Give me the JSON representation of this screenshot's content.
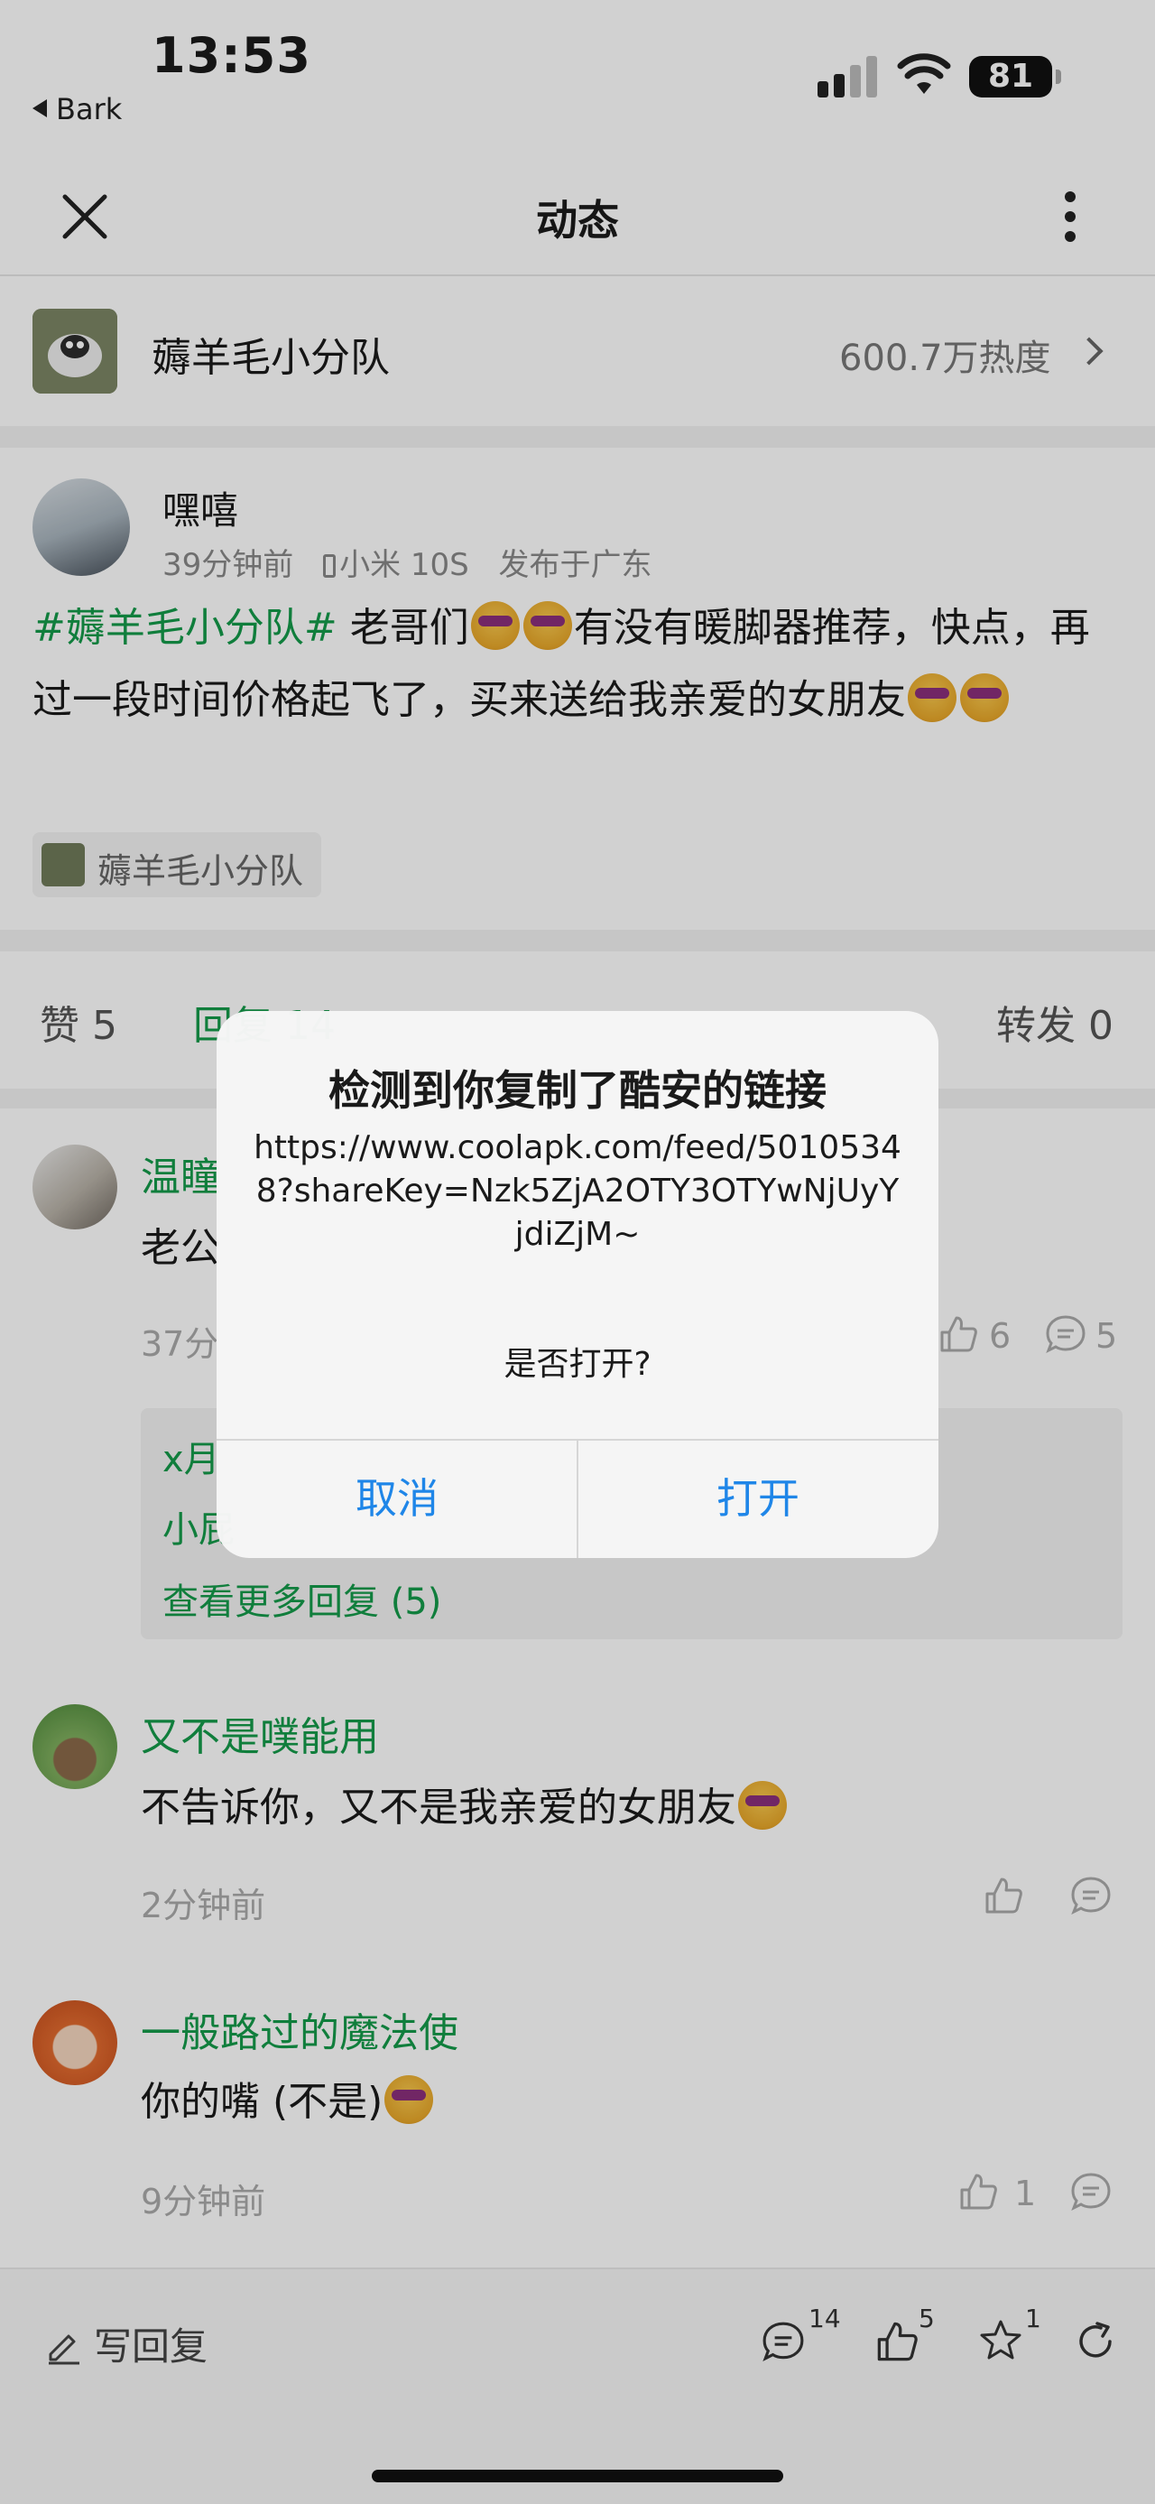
{
  "status_bar": {
    "time": "13:53",
    "back_app": "Bark",
    "battery": "81"
  },
  "nav": {
    "title": "动态"
  },
  "topic": {
    "name": "薅羊毛小分队",
    "heat": "600.7万热度"
  },
  "post": {
    "user": "嘿嘻",
    "time": "39分钟前",
    "device": "小米 10S",
    "location": "发布于广东",
    "hashtag": "#薅羊毛小分队#",
    "text_1": " 老哥们",
    "text_2": "有没有暖脚器推荐，快点，再过一段时间价格起飞了，买来送给我亲爱的女朋友",
    "tag": "薅羊毛小分队"
  },
  "actions": {
    "like": "赞 5",
    "reply": "回复 14",
    "repost": "转发 0"
  },
  "comments": [
    {
      "user": "温瞳",
      "text": "老公",
      "time": "37分",
      "likes": "6",
      "replies": "5",
      "sub_user_1": "x月",
      "sub_user_2": "小屁",
      "more_replies": "查看更多回复 (5)"
    },
    {
      "user": "又不是噗能用",
      "text": "不告诉你，又不是我亲爱的女朋友",
      "time": "2分钟前"
    },
    {
      "user": "一般路过的魔法使",
      "text": "你的嘴 (不是)",
      "time": "9分钟前",
      "likes": "1"
    }
  ],
  "bottom_bar": {
    "write_reply": "写回复",
    "comment_count": "14",
    "like_count": "5",
    "star_count": "1"
  },
  "dialog": {
    "title": "检测到你复制了酷安的链接",
    "url": "https://www.coolapk.com/feed/50105348?shareKey=Nzk5ZjA2OTY3OTYwNjUyYjdiZjM~",
    "question": "是否打开?",
    "cancel": "取消",
    "open": "打开"
  },
  "colors": {
    "accent_green": "#149a4a",
    "dialog_button_blue": "#1f86e8"
  }
}
